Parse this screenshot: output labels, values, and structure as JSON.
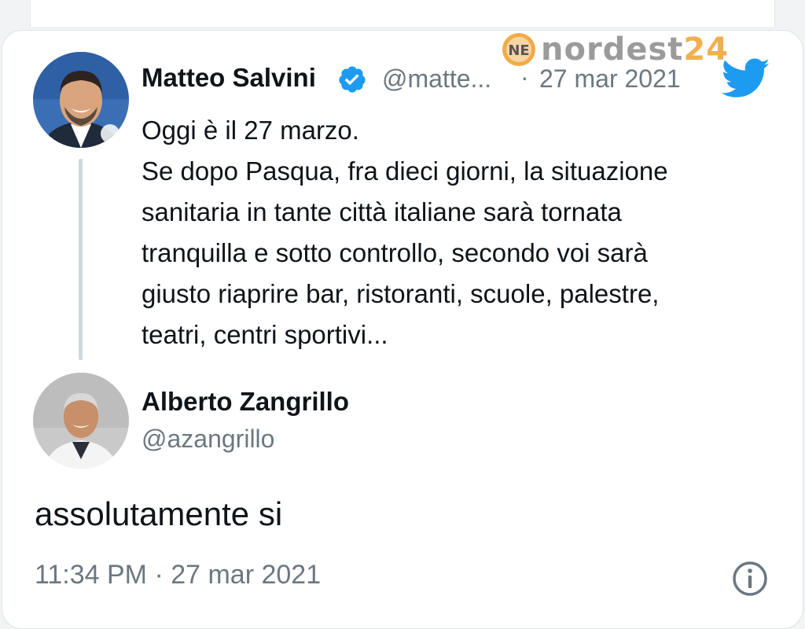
{
  "quoted_tweet": {
    "author_name": "Matteo Salvini",
    "author_handle": "@matte...",
    "separator": "·",
    "date": "27 mar 2021",
    "text_lines": [
      "Oggi è il 27 marzo.",
      "Se dopo Pasqua, fra dieci giorni, la situazione",
      "sanitaria in tante città italiane sarà tornata",
      "tranquilla e sotto controllo, secondo voi sarà",
      "giusto riaprire bar, ristoranti, scuole, palestre,",
      "teatri, centri sportivi..."
    ]
  },
  "reply_tweet": {
    "author_name": "Alberto Zangrillo",
    "author_handle": "@azangrillo",
    "text": "assolutamente si",
    "timestamp": "11:34 PM · 27 mar 2021"
  },
  "watermark": {
    "badge_text": "NE",
    "brand": "nordest",
    "brand_number": "24"
  },
  "icons": {
    "verified": "verified-badge-icon",
    "twitter": "twitter-bird-icon",
    "info": "info-icon"
  },
  "colors": {
    "text": "#0f1419",
    "secondary": "#6b7880",
    "twitter_blue": "#1d9bf0",
    "thread_line": "#cfd9de",
    "watermark_orange": "#f0a233"
  }
}
